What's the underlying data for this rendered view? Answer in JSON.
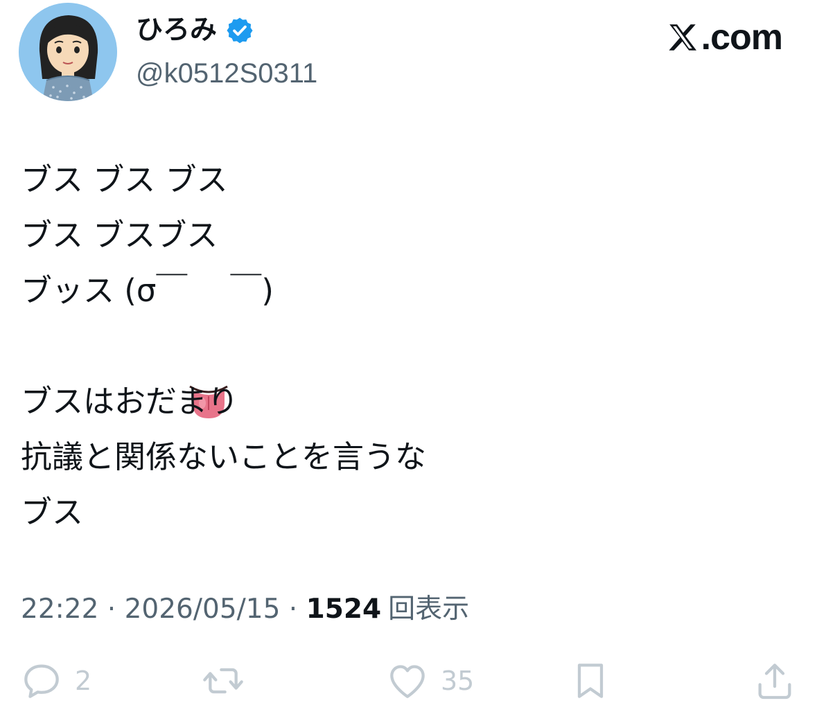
{
  "author": {
    "display_name": "ひろみ",
    "handle": "@k0512S0311",
    "avatar": "illustrated-woman-avatar",
    "verified": true
  },
  "brand": {
    "suffix": ".com",
    "logo": "x-logo"
  },
  "tweet": {
    "lines": [
      "ブス ブス ブス",
      "ブス ブスブス",
      "ブッス (σ￣",
      "",
      "ブスはおだまり",
      "抗議と関係ないことを言うな",
      "ブス"
    ],
    "line3_emoji": "tongue-emoji",
    "line3_tail": "￣)"
  },
  "meta": {
    "time": "22:22",
    "separator": " · ",
    "date": "2026/05/15",
    "views_count": "1524",
    "views_label": "回表示"
  },
  "actions": {
    "reply_count": "2",
    "retweet_count": "",
    "like_count": "35"
  },
  "colors": {
    "text": "#0f1419",
    "secondary": "#536471",
    "verified": "#1d9bf0",
    "action_icon": "#c2cbd2",
    "avatar_bg": "#8ec6ee"
  }
}
